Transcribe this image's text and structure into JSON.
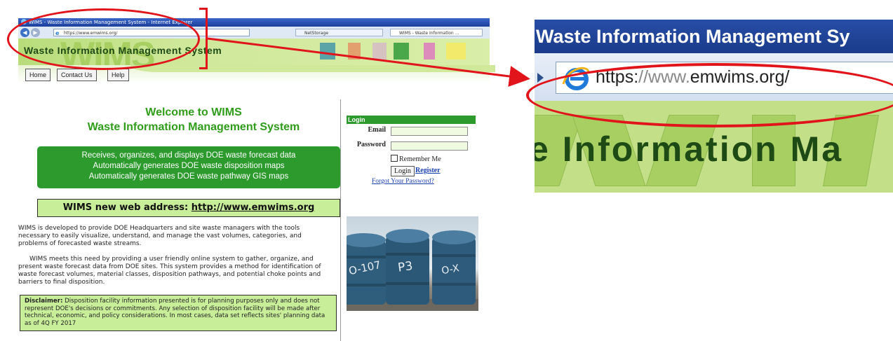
{
  "left_screenshot": {
    "browser": {
      "title": "WIMS - Waste Information Management System - Internet Explorer",
      "url": "https://www.emwims.org/",
      "tabs": [
        "NetStorage",
        "WIMS - Waste Information ..."
      ]
    },
    "site": {
      "banner_title": "Waste Information Management System",
      "nav": [
        "Home",
        "Contact Us",
        "Help"
      ]
    },
    "welcome": {
      "line1": "Welcome to WIMS",
      "line2": "Waste Information Management System"
    },
    "features": [
      "Receives, organizes, and displays DOE waste forecast data",
      "Automatically generates DOE waste disposition maps",
      "Automatically generates DOE waste pathway GIS maps"
    ],
    "address_notice": {
      "label": "WIMS new web address:",
      "url": "http://www.emwims.org"
    },
    "paragraph1": "WIMS is developed to provide DOE Headquarters and site waste managers with the tools necessary to easily visualize, understand, and manage the vast volumes, categories, and problems of forecasted waste streams.",
    "paragraph2": "WIMS meets this need by providing a user friendly online system to gather, organize, and present waste forecast data from DOE sites. This system provides a method for identification of waste forecast volumes, material classes, disposition pathways, and potential choke points and barriers to final disposition.",
    "disclaimer": {
      "label": "Disclaimer:",
      "text": "Disposition facility information presented is for planning purposes only and does not represent DOE's decisions or commitments. Any selection of disposition facility will be made after technical, economic, and policy considerations. In most cases, data set reflects sites' planning data as of 4Q FY 2017"
    },
    "login": {
      "header": "Login",
      "email_label": "Email",
      "password_label": "Password",
      "remember_label": "Remember Me",
      "login_button": "Login",
      "register_link": "Register",
      "forgot_link": "Forgot Your Password?"
    },
    "barrel_labels": [
      "O-107",
      "P3",
      "O-X"
    ]
  },
  "zoom_panel": {
    "title_fragment": "Waste Information Management Sy",
    "url_prefix": "https:",
    "url_slashes": "//www.",
    "url_domain": "emwims.org/",
    "banner_fragment": "e Information Ma"
  },
  "colors": {
    "annotation_red": "#e0141a",
    "site_green": "#2d9a2e",
    "banner_green": "#c3df87",
    "ie_blue": "#1d3f9c"
  }
}
